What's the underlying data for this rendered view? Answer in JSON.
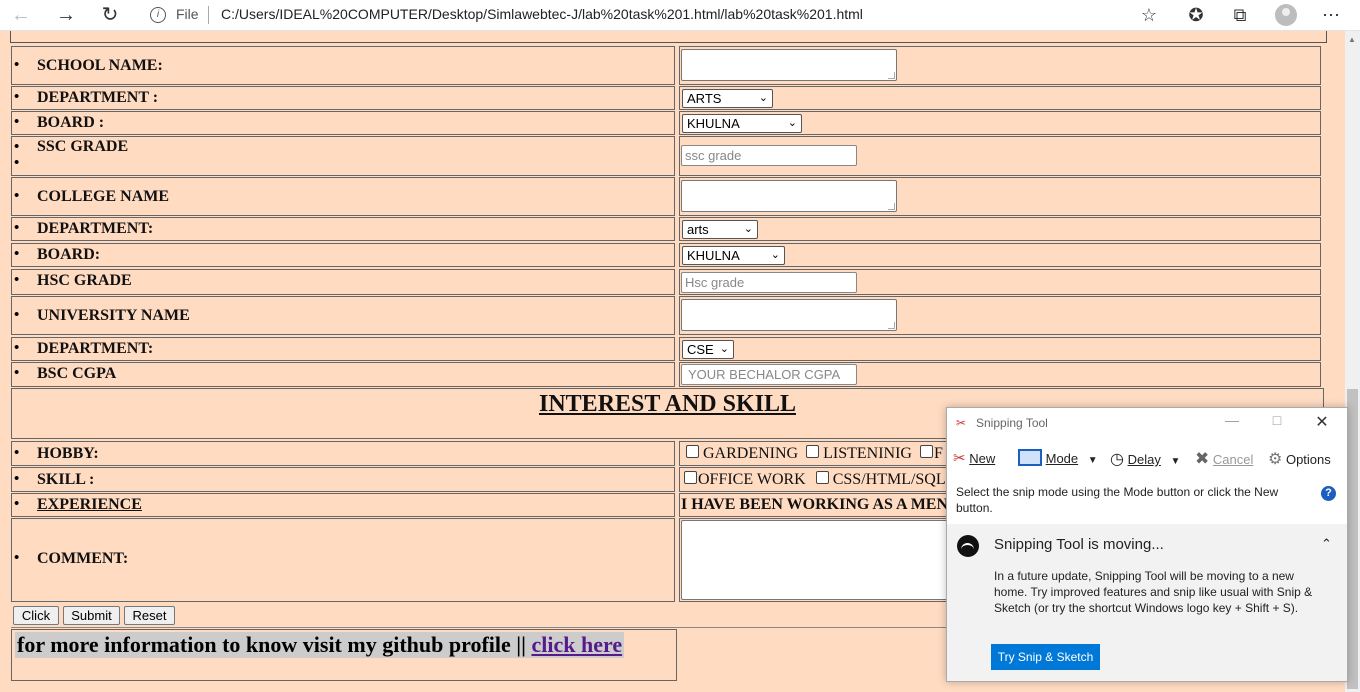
{
  "browser": {
    "file_label": "File",
    "url": "C:/Users/IDEAL%20COMPUTER/Desktop/Simlawebtec-J/lab%20task%201.html/lab%20task%201.html",
    "icons": [
      "back-icon",
      "forward-icon",
      "refresh-icon",
      "info-icon",
      "favorite-add-icon",
      "favorites-icon",
      "collections-icon",
      "profile-icon",
      "more-icon"
    ]
  },
  "form": {
    "school_name_label": "SCHOOL NAME:",
    "school_department_label": "DEPARTMENT :",
    "school_department_value": "ARTS",
    "school_board_label": "BOARD :",
    "school_board_value": "KHULNA",
    "ssc_grade_label": "SSC GRADE",
    "ssc_grade_placeholder": "ssc grade",
    "college_name_label": "COLLEGE NAME",
    "college_department_label": "DEPARTMENT:",
    "college_department_value": "arts",
    "college_board_label": "BOARD:",
    "college_board_value": "KHULNA",
    "hsc_grade_label": "HSC GRADE",
    "hsc_grade_placeholder": "Hsc grade",
    "university_name_label": "UNIVERSITY NAME",
    "university_department_label": "DEPARTMENT:",
    "university_department_value": "CSE",
    "bsc_cgpa_label": "BSC CGPA",
    "bsc_cgpa_placeholder": "YOUR BECHALOR CGPA",
    "section_heading": "INTEREST AND SKILL",
    "hobby_label": "HOBBY:",
    "hobbies": [
      "GARDENING",
      "LISTENINIG",
      "F"
    ],
    "skill_label": "SKILL :",
    "skills": [
      "OFFICE WORK",
      "CSS/HTML/SQL"
    ],
    "experience_label": "EXPERIENCE",
    "experience_text": "I HAVE BEEN WORKING AS A MEN",
    "comment_label": "COMMENT:",
    "buttons": {
      "click": "Click",
      "submit": "Submit",
      "reset": "Reset"
    },
    "info_text": "for more information to know visit my github profile ||",
    "info_link": "click here"
  },
  "snipping_tool": {
    "title": "Snipping Tool",
    "new_label": "New",
    "mode_label": "Mode",
    "delay_label": "Delay",
    "cancel_label": "Cancel",
    "options_label": "Options",
    "description": "Select the snip mode using the Mode button or click the New button.",
    "moving_heading": "Snipping Tool is moving...",
    "moving_body": "In a future update, Snipping Tool will be moving to a new home. Try improved features and snip like usual with Snip & Sketch (or try the shortcut Windows logo key + Shift + S).",
    "try_button": "Try Snip & Sketch"
  }
}
